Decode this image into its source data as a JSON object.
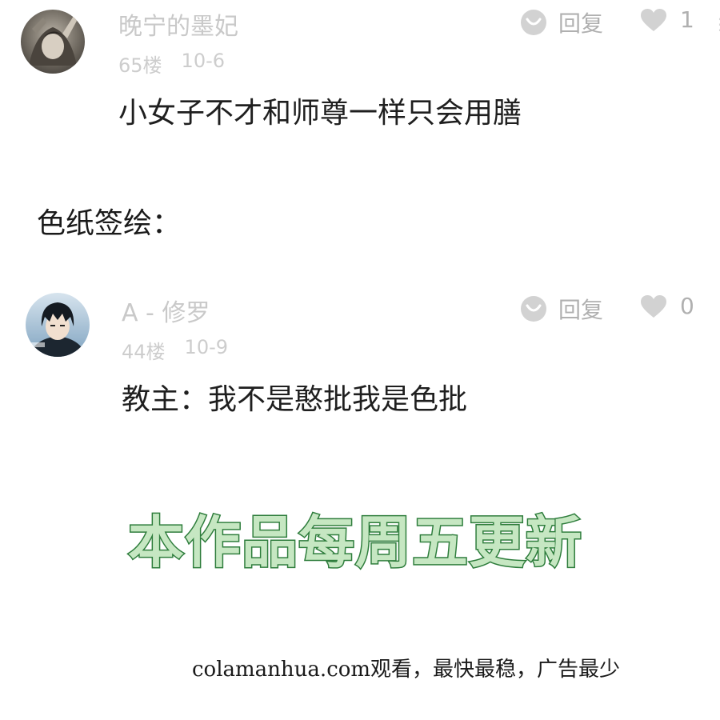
{
  "comments": [
    {
      "username": "晚宁的墨妃",
      "floor": "65楼",
      "date": "10-6",
      "reply_label": "回复",
      "like_count": "1",
      "text": "小女子不才和师尊一样只会用膳"
    },
    {
      "username": "A - 修罗",
      "floor": "44楼",
      "date": "10-9",
      "reply_label": "回复",
      "like_count": "0",
      "text": "教主：我不是憨批我是色批"
    }
  ],
  "section_label": "色纸签绘：",
  "banner_text": "本作品每周五更新",
  "footer_text": "colamanhua.com观看，最快最稳，广告最少",
  "colors": {
    "username": "#c9c9c9",
    "meta": "#cdcdcd",
    "action_gray": "#b0b0b0",
    "icon_gray": "#d2d2d2",
    "banner_fill": "#c6e7c2",
    "banner_stroke": "#2e7d3c"
  },
  "icons": {
    "reply": "speech-bubble-icon",
    "like": "heart-icon"
  }
}
